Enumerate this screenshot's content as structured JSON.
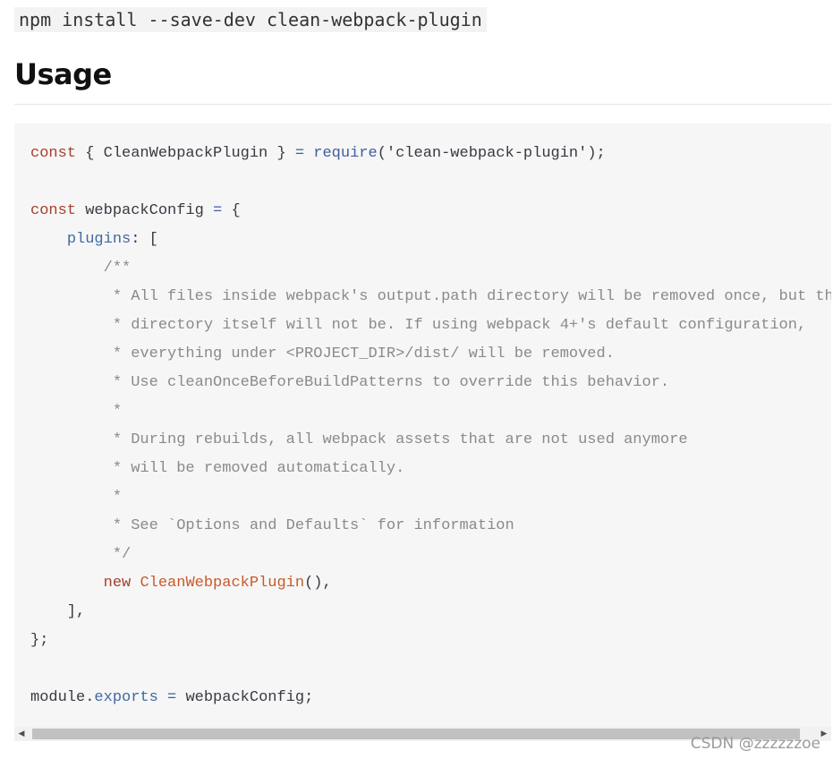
{
  "install": {
    "command": "npm install --save-dev clean-webpack-plugin"
  },
  "heading": {
    "title": "Usage"
  },
  "code": {
    "lines": [
      [
        [
          "kw",
          "const"
        ],
        [
          "str",
          " { CleanWebpackPlugin } "
        ],
        [
          "fn",
          "="
        ],
        [
          "str",
          " "
        ],
        [
          "fn",
          "require"
        ],
        [
          "str",
          "('clean-webpack-plugin');"
        ]
      ],
      [],
      [
        [
          "kw",
          "const"
        ],
        [
          "str",
          " webpackConfig "
        ],
        [
          "fn",
          "="
        ],
        [
          "str",
          " {"
        ]
      ],
      [
        [
          "str",
          "    "
        ],
        [
          "prop",
          "plugins"
        ],
        [
          "str",
          ": ["
        ]
      ],
      [
        [
          "cmt",
          "        /**"
        ]
      ],
      [
        [
          "cmt",
          "         * All files inside webpack's output.path directory will be removed once, but the"
        ]
      ],
      [
        [
          "cmt",
          "         * directory itself will not be. If using webpack 4+'s default configuration,"
        ]
      ],
      [
        [
          "cmt",
          "         * everything under <PROJECT_DIR>/dist/ will be removed."
        ]
      ],
      [
        [
          "cmt",
          "         * Use cleanOnceBeforeBuildPatterns to override this behavior."
        ]
      ],
      [
        [
          "cmt",
          "         *"
        ]
      ],
      [
        [
          "cmt",
          "         * During rebuilds, all webpack assets that are not used anymore"
        ]
      ],
      [
        [
          "cmt",
          "         * will be removed automatically."
        ]
      ],
      [
        [
          "cmt",
          "         *"
        ]
      ],
      [
        [
          "cmt",
          "         * See `Options and Defaults` for information"
        ]
      ],
      [
        [
          "cmt",
          "         */"
        ]
      ],
      [
        [
          "str",
          "        "
        ],
        [
          "kw",
          "new"
        ],
        [
          "str",
          " "
        ],
        [
          "cls",
          "CleanWebpackPlugin"
        ],
        [
          "str",
          "(),"
        ]
      ],
      [
        [
          "str",
          "    ],"
        ]
      ],
      [
        [
          "str",
          "};"
        ]
      ],
      [],
      [
        [
          "str",
          "module."
        ],
        [
          "prop",
          "exports"
        ],
        [
          "str",
          " "
        ],
        [
          "fn",
          "="
        ],
        [
          "str",
          " webpackConfig;"
        ]
      ]
    ]
  },
  "scrollbar": {
    "left_arrow": "◀",
    "right_arrow": "▶"
  },
  "watermark": {
    "text": "CSDN @zzzzzzoe"
  }
}
